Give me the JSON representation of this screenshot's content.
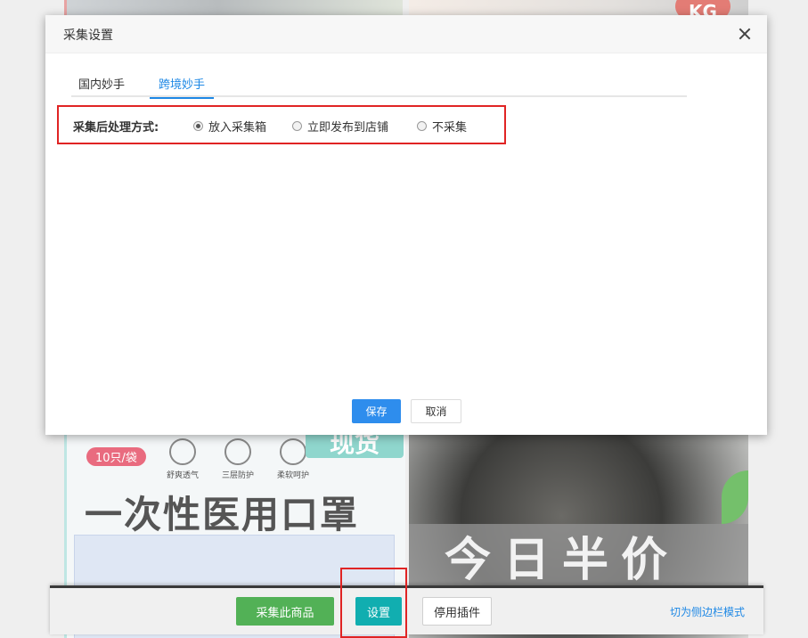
{
  "background": {
    "tr_badge": "KG",
    "bl_tag": "10只/袋",
    "bl_features": [
      "舒爽透气",
      "三层防护",
      "柔软呵护"
    ],
    "bl_stamp": "现货",
    "bl_title": "一次性医用口罩",
    "br_sale_text": "今日半价"
  },
  "dialog": {
    "title": "采集设置",
    "tabs": [
      {
        "label": "国内妙手",
        "active": false
      },
      {
        "label": "跨境妙手",
        "active": true
      }
    ],
    "option_label": "采集后处理方式:",
    "options": [
      {
        "label": "放入采集箱",
        "checked": true
      },
      {
        "label": "立即发布到店铺",
        "checked": false
      },
      {
        "label": "不采集",
        "checked": false
      }
    ],
    "save_label": "保存",
    "cancel_label": "取消"
  },
  "toolbar": {
    "collect_label": "采集此商品",
    "settings_label": "设置",
    "disable_label": "停用插件",
    "sidebar_link": "切为侧边栏模式"
  },
  "colors": {
    "accent_blue": "#2e8ded",
    "collect_green": "#52b156",
    "settings_teal": "#11aeb0",
    "highlight_red": "#e02424"
  }
}
